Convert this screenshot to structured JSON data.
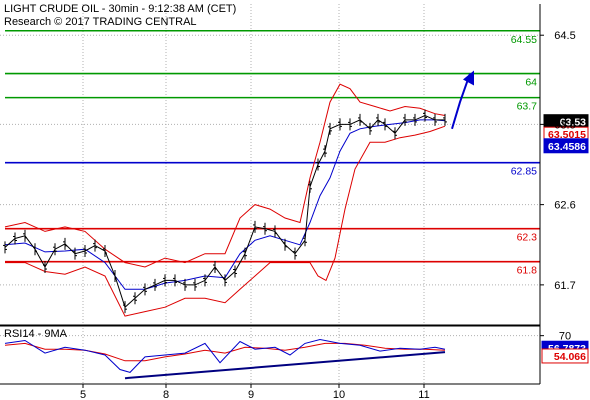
{
  "chart_data": {
    "type": "candlestick-line",
    "title": "LIGHT CRUDE OIL - 30min - 9:12:38 AM (CET)",
    "subtitle": "Research © 2017 TRADING CENTRAL",
    "price_axis": {
      "ylim": [
        61.25,
        64.85
      ],
      "ticks": [
        {
          "label": "64.5",
          "value": 64.5
        },
        {
          "label": "63.5",
          "value": 63.5
        },
        {
          "label": "62.6",
          "value": 62.6
        },
        {
          "label": "61.7",
          "value": 61.7
        }
      ]
    },
    "x_axis": {
      "xlim": [
        0,
        590
      ],
      "ticks": [
        {
          "label": "5",
          "x": 83
        },
        {
          "label": "8",
          "x": 166
        },
        {
          "label": "9",
          "x": 251
        },
        {
          "label": "10",
          "x": 339
        },
        {
          "label": "11",
          "x": 424
        }
      ]
    },
    "levels": [
      {
        "label": "64.55",
        "value": 64.55,
        "color": "#009900"
      },
      {
        "label": "64",
        "value": 64.07,
        "color": "#009900"
      },
      {
        "label": "63.7",
        "value": 63.8,
        "color": "#009900"
      },
      {
        "label": "62.85",
        "value": 63.07,
        "color": "#0000cc"
      },
      {
        "label": "62.3",
        "value": 62.33,
        "color": "#dd0000"
      },
      {
        "label": "61.8",
        "value": 61.96,
        "color": "#dd0000"
      }
    ],
    "price_tags": [
      {
        "label": "63.53",
        "value": 63.53,
        "bg": "#000000",
        "fg": "#ffffff"
      },
      {
        "label": "63.5015",
        "value": 63.39,
        "bg": "#ffffff",
        "fg": "#dd0000",
        "border": "#dd0000"
      },
      {
        "label": "63.4586",
        "value": 63.26,
        "bg": "#0000cc",
        "fg": "#ffffff"
      }
    ],
    "price_points": [
      [
        5,
        62.12
      ],
      [
        15,
        62.22
      ],
      [
        25,
        62.25
      ],
      [
        35,
        62.1
      ],
      [
        45,
        61.9
      ],
      [
        55,
        62.1
      ],
      [
        65,
        62.16
      ],
      [
        75,
        62.05
      ],
      [
        85,
        62.08
      ],
      [
        95,
        62.14
      ],
      [
        105,
        62.08
      ],
      [
        115,
        61.8
      ],
      [
        125,
        61.45
      ],
      [
        135,
        61.55
      ],
      [
        145,
        61.65
      ],
      [
        155,
        61.7
      ],
      [
        165,
        61.75
      ],
      [
        175,
        61.75
      ],
      [
        185,
        61.7
      ],
      [
        195,
        61.7
      ],
      [
        205,
        61.75
      ],
      [
        215,
        61.9
      ],
      [
        225,
        61.75
      ],
      [
        235,
        61.85
      ],
      [
        245,
        62.05
      ],
      [
        255,
        62.35
      ],
      [
        265,
        62.33
      ],
      [
        275,
        62.3
      ],
      [
        285,
        62.15
      ],
      [
        295,
        62.05
      ],
      [
        305,
        62.2
      ],
      [
        310,
        62.8
      ],
      [
        318,
        63.05
      ],
      [
        325,
        63.2
      ],
      [
        330,
        63.45
      ],
      [
        340,
        63.5
      ],
      [
        350,
        63.5
      ],
      [
        360,
        63.55
      ],
      [
        370,
        63.45
      ],
      [
        378,
        63.55
      ],
      [
        385,
        63.5
      ],
      [
        395,
        63.4
      ],
      [
        405,
        63.55
      ],
      [
        415,
        63.55
      ],
      [
        425,
        63.6
      ],
      [
        435,
        63.55
      ],
      [
        445,
        63.55
      ]
    ],
    "bands": {
      "upper": [
        [
          5,
          62.35
        ],
        [
          25,
          62.4
        ],
        [
          45,
          62.3
        ],
        [
          65,
          62.35
        ],
        [
          85,
          62.3
        ],
        [
          105,
          62.1
        ],
        [
          125,
          61.95
        ],
        [
          145,
          61.9
        ],
        [
          165,
          62.0
        ],
        [
          185,
          61.95
        ],
        [
          205,
          62.05
        ],
        [
          225,
          62.05
        ],
        [
          240,
          62.45
        ],
        [
          255,
          62.6
        ],
        [
          270,
          62.55
        ],
        [
          285,
          62.45
        ],
        [
          300,
          62.4
        ],
        [
          310,
          62.9
        ],
        [
          320,
          63.3
        ],
        [
          330,
          63.75
        ],
        [
          340,
          63.95
        ],
        [
          350,
          63.9
        ],
        [
          360,
          63.75
        ],
        [
          375,
          63.7
        ],
        [
          390,
          63.65
        ],
        [
          405,
          63.7
        ],
        [
          420,
          63.68
        ],
        [
          435,
          63.62
        ],
        [
          445,
          63.6
        ]
      ],
      "lower": [
        [
          5,
          61.95
        ],
        [
          25,
          61.95
        ],
        [
          45,
          61.85
        ],
        [
          65,
          61.82
        ],
        [
          85,
          61.9
        ],
        [
          105,
          61.8
        ],
        [
          125,
          61.35
        ],
        [
          145,
          61.4
        ],
        [
          165,
          61.45
        ],
        [
          185,
          61.55
        ],
        [
          205,
          61.55
        ],
        [
          225,
          61.5
        ],
        [
          240,
          61.65
        ],
        [
          255,
          61.8
        ],
        [
          270,
          61.95
        ],
        [
          285,
          61.95
        ],
        [
          300,
          61.95
        ],
        [
          310,
          61.95
        ],
        [
          318,
          61.8
        ],
        [
          326,
          61.75
        ],
        [
          335,
          62.0
        ],
        [
          345,
          62.55
        ],
        [
          355,
          63.0
        ],
        [
          370,
          63.3
        ],
        [
          385,
          63.3
        ],
        [
          400,
          63.35
        ],
        [
          415,
          63.38
        ],
        [
          430,
          63.42
        ],
        [
          445,
          63.48
        ]
      ],
      "mid": [
        [
          5,
          62.15
        ],
        [
          25,
          62.17
        ],
        [
          45,
          62.07
        ],
        [
          65,
          62.08
        ],
        [
          85,
          62.1
        ],
        [
          105,
          61.95
        ],
        [
          125,
          61.65
        ],
        [
          145,
          61.65
        ],
        [
          165,
          61.72
        ],
        [
          185,
          61.75
        ],
        [
          205,
          61.8
        ],
        [
          225,
          61.78
        ],
        [
          240,
          62.05
        ],
        [
          255,
          62.2
        ],
        [
          270,
          62.25
        ],
        [
          285,
          62.2
        ],
        [
          300,
          62.15
        ],
        [
          310,
          62.4
        ],
        [
          320,
          62.7
        ],
        [
          330,
          62.9
        ],
        [
          340,
          63.2
        ],
        [
          350,
          63.4
        ],
        [
          360,
          63.45
        ],
        [
          375,
          63.48
        ],
        [
          390,
          63.5
        ],
        [
          405,
          63.52
        ],
        [
          420,
          63.55
        ],
        [
          435,
          63.55
        ],
        [
          445,
          63.54
        ]
      ]
    },
    "forecast_arrow": [
      [
        452,
        63.45
      ],
      [
        460,
        63.75
      ],
      [
        470,
        64.07
      ]
    ],
    "rsi": {
      "label": "RSI14 - 9MA",
      "ylim": [
        20,
        80
      ],
      "ticks": [
        {
          "label": "70",
          "value": 70
        }
      ],
      "tags": [
        {
          "label": "56.7873",
          "value": 57.0,
          "bg": "#0000cc",
          "fg": "#ffffff"
        },
        {
          "label": "54.066",
          "value": 49.0,
          "bg": "#ffffff",
          "fg": "#dd0000",
          "border": "#dd0000"
        }
      ],
      "trendline": [
        [
          125,
          26
        ],
        [
          445,
          53
        ]
      ],
      "rsi_points": [
        [
          5,
          62
        ],
        [
          25,
          65
        ],
        [
          45,
          52
        ],
        [
          65,
          58
        ],
        [
          85,
          55
        ],
        [
          105,
          50
        ],
        [
          120,
          35
        ],
        [
          130,
          32
        ],
        [
          145,
          48
        ],
        [
          165,
          50
        ],
        [
          185,
          52
        ],
        [
          205,
          62
        ],
        [
          220,
          42
        ],
        [
          240,
          64
        ],
        [
          255,
          56
        ],
        [
          275,
          58
        ],
        [
          290,
          50
        ],
        [
          305,
          62
        ],
        [
          320,
          66
        ],
        [
          340,
          62
        ],
        [
          360,
          60
        ],
        [
          380,
          54
        ],
        [
          400,
          57
        ],
        [
          420,
          56
        ],
        [
          435,
          58
        ],
        [
          445,
          56
        ]
      ],
      "ma_points": [
        [
          5,
          60
        ],
        [
          25,
          62
        ],
        [
          45,
          56
        ],
        [
          65,
          56
        ],
        [
          85,
          55
        ],
        [
          105,
          51
        ],
        [
          125,
          44
        ],
        [
          145,
          44
        ],
        [
          165,
          48
        ],
        [
          185,
          51
        ],
        [
          205,
          55
        ],
        [
          225,
          52
        ],
        [
          245,
          58
        ],
        [
          265,
          57
        ],
        [
          285,
          55
        ],
        [
          305,
          58
        ],
        [
          325,
          62
        ],
        [
          345,
          62
        ],
        [
          365,
          60
        ],
        [
          385,
          57
        ],
        [
          405,
          56
        ],
        [
          425,
          56
        ],
        [
          445,
          55
        ]
      ]
    },
    "colors": {
      "price": "#000000",
      "bands": "#dd0000",
      "mid_band": "#0000cc",
      "arrow": "#0000cc",
      "rsi": "#0000cc",
      "rsi_ma": "#dd0000",
      "support": "#dd0000",
      "resistance": "#009900",
      "pivot": "#0000cc"
    }
  }
}
